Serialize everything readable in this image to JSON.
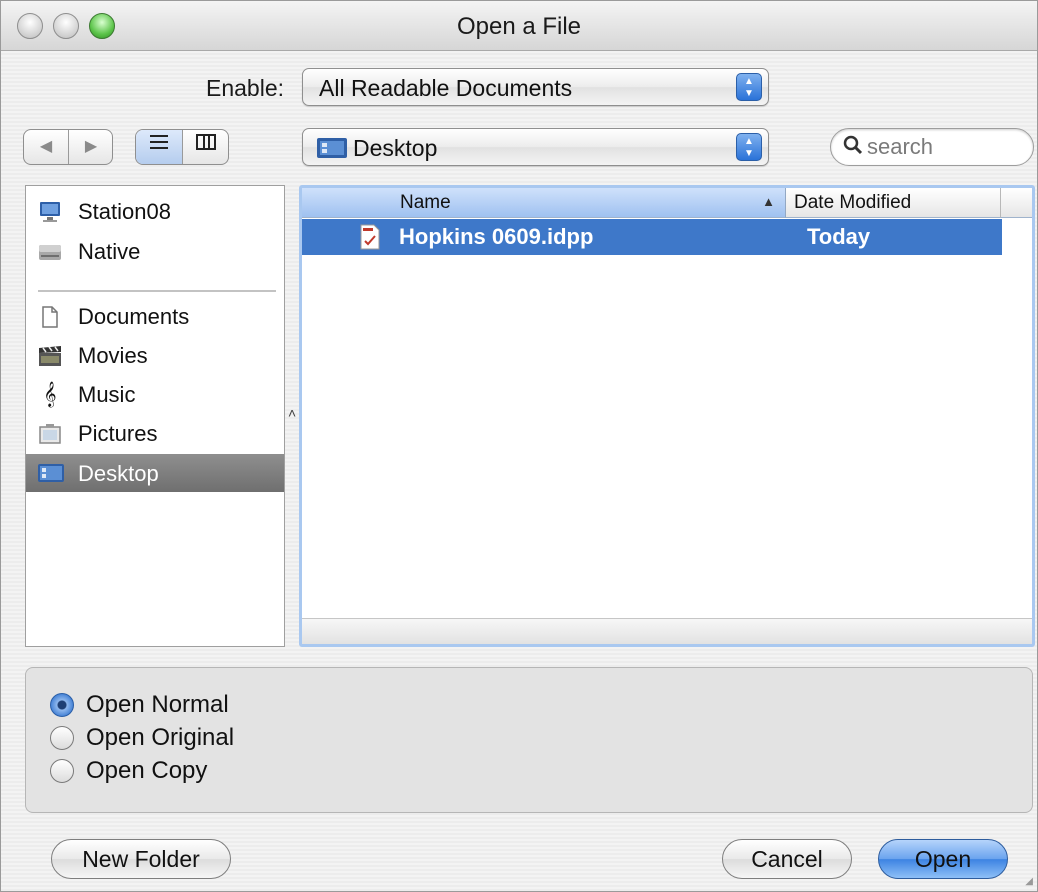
{
  "window": {
    "title": "Open a File"
  },
  "enable": {
    "label": "Enable:",
    "value": "All Readable Documents"
  },
  "nav": {
    "back_icon": "back-arrow-icon",
    "forward_icon": "forward-arrow-icon",
    "list_view_icon": "list-view-icon",
    "column_view_icon": "column-view-icon"
  },
  "location": {
    "value": "Desktop",
    "icon": "desktop-folder-icon"
  },
  "search": {
    "placeholder": "search",
    "icon": "magnifier-icon"
  },
  "sidebar": {
    "devices": [
      {
        "label": "Station08",
        "icon": "computer-icon"
      },
      {
        "label": "Native",
        "icon": "hard-drive-icon"
      }
    ],
    "places": [
      {
        "label": "Documents",
        "icon": "document-icon"
      },
      {
        "label": "Movies",
        "icon": "clapperboard-icon"
      },
      {
        "label": "Music",
        "icon": "music-note-icon"
      },
      {
        "label": "Pictures",
        "icon": "picture-icon"
      },
      {
        "label": "Desktop",
        "icon": "desktop-icon",
        "selected": true
      }
    ]
  },
  "file_list": {
    "columns": {
      "name": "Name",
      "date": "Date Modified"
    },
    "rows": [
      {
        "name": "Hopkins 0609.idpp",
        "date": "Today",
        "selected": true,
        "icon": "document-file-icon"
      }
    ]
  },
  "options": {
    "radios": [
      {
        "label": "Open Normal",
        "checked": true
      },
      {
        "label": "Open Original",
        "checked": false
      },
      {
        "label": "Open Copy",
        "checked": false
      }
    ]
  },
  "buttons": {
    "new_folder": "New Folder",
    "cancel": "Cancel",
    "open": "Open"
  },
  "colors": {
    "selection": "#3e78c9",
    "default_button": "#3c83e2",
    "sidebar_selection": "#7f7f7f"
  }
}
